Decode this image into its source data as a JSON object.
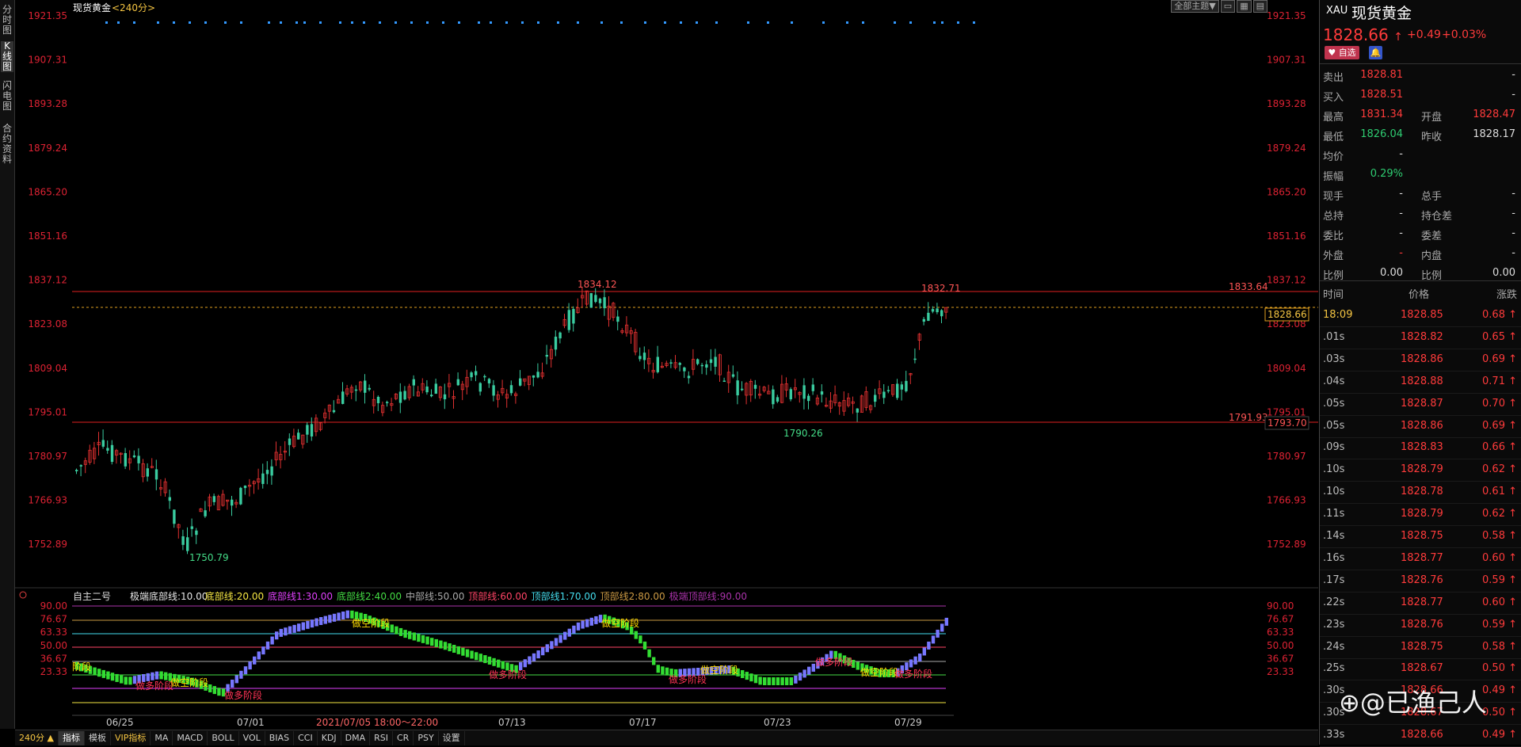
{
  "left_tabs": [
    "分时图",
    "K线图",
    "闪电图",
    "合约资料"
  ],
  "chart": {
    "title": "现货黄金",
    "period": "<240分>",
    "theme_button": "全部主题▼",
    "price_levels": [
      "1921.35",
      "1907.31",
      "1893.28",
      "1879.24",
      "1865.20",
      "1851.16",
      "1837.12",
      "1823.08",
      "1809.04",
      "1795.01",
      "1780.97",
      "1766.93",
      "1752.89"
    ],
    "x_labels": [
      "06/25",
      "07/01",
      "07/13",
      "07/17",
      "07/23",
      "07/29"
    ],
    "crosshair_date": "2021/07/05  18:00～22:00",
    "annotations": {
      "high1": "1834.12",
      "high2": "1832.71",
      "low1": "1750.79",
      "low2": "1790.26",
      "resistance": "1833.64",
      "support": "1791.93",
      "current": "1828.66",
      "support_tag": "1793.70"
    }
  },
  "indicator": {
    "name": "自主二号",
    "lines": [
      {
        "label": "极端底部线:10.00",
        "color": "#e6e6e6"
      },
      {
        "label": "底部线:20.00",
        "color": "#f5e642"
      },
      {
        "label": "底部线1:30.00",
        "color": "#e040fb"
      },
      {
        "label": "底部线2:40.00",
        "color": "#44dd44"
      },
      {
        "label": "中部线:50.00",
        "color": "#aaaaaa"
      },
      {
        "label": "顶部线:60.00",
        "color": "#ff4466"
      },
      {
        "label": "顶部线1:70.00",
        "color": "#44ddee"
      },
      {
        "label": "顶部线2:80.00",
        "color": "#cc9a44"
      },
      {
        "label": "极端顶部线:90.00",
        "color": "#aa33aa"
      }
    ],
    "levels": [
      "90.00",
      "76.67",
      "63.33",
      "50.00",
      "36.67",
      "23.33"
    ],
    "text_labels": [
      {
        "text": "阶段",
        "color": "#ffdd00"
      },
      {
        "text": "做多阶段",
        "color": "#ff3355"
      },
      {
        "text": "做空阶段",
        "color": "#ffdd00"
      },
      {
        "text": "做多阶段",
        "color": "#ff3355"
      },
      {
        "text": "做空阶段",
        "color": "#ffdd00"
      },
      {
        "text": "做多阶段",
        "color": "#ff3355"
      },
      {
        "text": "做空阶段",
        "color": "#ffdd00"
      },
      {
        "text": "做多阶段",
        "color": "#ff3355"
      },
      {
        "text": "做空阶段",
        "color": "#ffdd00"
      },
      {
        "text": "做多阶段",
        "color": "#ff3355"
      },
      {
        "text": "做空阶段",
        "color": "#ffdd00"
      },
      {
        "text": "做多阶段",
        "color": "#ff3355"
      }
    ]
  },
  "bottom_toolbar": {
    "period": "240分 ▲",
    "buttons": [
      "指标",
      "模板",
      "VIP指标",
      "MA",
      "MACD",
      "BOLL",
      "VOL",
      "BIAS",
      "CCI",
      "KDJ",
      "DMA",
      "RSI",
      "CR",
      "PSY",
      "设置"
    ]
  },
  "quote": {
    "symbol": "XAU",
    "name": "现货黄金",
    "price": "1828.66",
    "change": "+0.49",
    "change_pct": "+0.03%",
    "self_select": "自选",
    "rows": [
      {
        "l1": "卖出",
        "v1": "1828.81",
        "c1": "red",
        "l2": "",
        "v2": "-",
        "c2": "white"
      },
      {
        "l1": "买入",
        "v1": "1828.51",
        "c1": "red",
        "l2": "",
        "v2": "-",
        "c2": "white"
      },
      {
        "l1": "最高",
        "v1": "1831.34",
        "c1": "red",
        "l2": "开盘",
        "v2": "1828.47",
        "c2": "red"
      },
      {
        "l1": "最低",
        "v1": "1826.04",
        "c1": "green",
        "l2": "昨收",
        "v2": "1828.17",
        "c2": "white"
      },
      {
        "l1": "均价",
        "v1": "-",
        "c1": "white",
        "l2": "",
        "v2": "",
        "c2": "white"
      },
      {
        "l1": "振幅",
        "v1": "0.29%",
        "c1": "green",
        "l2": "",
        "v2": "",
        "c2": "white"
      },
      {
        "l1": "现手",
        "v1": "-",
        "c1": "white",
        "l2": "总手",
        "v2": "-",
        "c2": "white"
      },
      {
        "l1": "总持",
        "v1": "-",
        "c1": "white",
        "l2": "持仓差",
        "v2": "-",
        "c2": "white"
      },
      {
        "l1": "委比",
        "v1": "-",
        "c1": "white",
        "l2": "委差",
        "v2": "-",
        "c2": "white"
      },
      {
        "l1": "外盘",
        "v1": "-",
        "c1": "red",
        "l2": "内盘",
        "v2": "-",
        "c2": "white"
      },
      {
        "l1": "比例",
        "v1": "0.00",
        "c1": "white",
        "l2": "比例",
        "v2": "0.00",
        "c2": "white"
      }
    ],
    "ticks_header": {
      "time": "时间",
      "price": "价格",
      "change": "涨跌"
    },
    "ticks": [
      {
        "t": "18:09",
        "p": "1828.85",
        "c": "0.68"
      },
      {
        "t": ".01s",
        "p": "1828.82",
        "c": "0.65"
      },
      {
        "t": ".03s",
        "p": "1828.86",
        "c": "0.69"
      },
      {
        "t": ".04s",
        "p": "1828.88",
        "c": "0.71"
      },
      {
        "t": ".05s",
        "p": "1828.87",
        "c": "0.70"
      },
      {
        "t": ".05s",
        "p": "1828.86",
        "c": "0.69"
      },
      {
        "t": ".09s",
        "p": "1828.83",
        "c": "0.66"
      },
      {
        "t": ".10s",
        "p": "1828.79",
        "c": "0.62"
      },
      {
        "t": ".10s",
        "p": "1828.78",
        "c": "0.61"
      },
      {
        "t": ".11s",
        "p": "1828.79",
        "c": "0.62"
      },
      {
        "t": ".14s",
        "p": "1828.75",
        "c": "0.58"
      },
      {
        "t": ".16s",
        "p": "1828.77",
        "c": "0.60"
      },
      {
        "t": ".17s",
        "p": "1828.76",
        "c": "0.59"
      },
      {
        "t": ".22s",
        "p": "1828.77",
        "c": "0.60"
      },
      {
        "t": ".23s",
        "p": "1828.76",
        "c": "0.59"
      },
      {
        "t": ".24s",
        "p": "1828.75",
        "c": "0.58"
      },
      {
        "t": ".25s",
        "p": "1828.67",
        "c": "0.50"
      },
      {
        "t": ".30s",
        "p": "1828.66",
        "c": "0.49"
      },
      {
        "t": ".30s",
        "p": "1828.67",
        "c": "0.50"
      },
      {
        "t": ".33s",
        "p": "1828.66",
        "c": "0.49"
      }
    ]
  },
  "watermark": "⊕@已渔己人"
}
